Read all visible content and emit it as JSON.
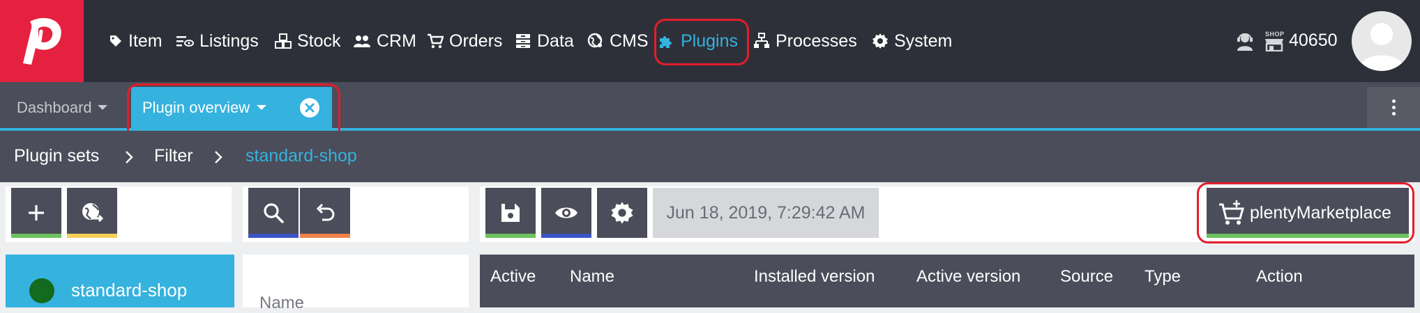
{
  "nav": {
    "items": [
      {
        "label": "Item",
        "icon": "tag-icon"
      },
      {
        "label": "Listings",
        "icon": "listings-icon"
      },
      {
        "label": "Stock",
        "icon": "cubes-icon"
      },
      {
        "label": "CRM",
        "icon": "users-icon"
      },
      {
        "label": "Orders",
        "icon": "cart-icon"
      },
      {
        "label": "Data",
        "icon": "archive-icon"
      },
      {
        "label": "CMS",
        "icon": "globe-icon"
      },
      {
        "label": "Plugins",
        "icon": "puzzle-icon",
        "active": true
      },
      {
        "label": "Processes",
        "icon": "sitemap-icon"
      },
      {
        "label": "System",
        "icon": "gear-icon"
      }
    ],
    "shop_badge": "SHOP",
    "shop_id": "40650"
  },
  "tabs": {
    "dashboard": "Dashboard",
    "plugin_overview": "Plugin overview"
  },
  "breadcrumb": {
    "items": [
      "Plugin sets",
      "Filter",
      "standard-shop"
    ]
  },
  "toolbar": {
    "timestamp": "Jun 18, 2019, 7:29:42 AM",
    "marketplace_label": "plentyMarketplace"
  },
  "sidebar": {
    "active_set": "standard-shop"
  },
  "filter": {
    "name_label": "Name"
  },
  "table": {
    "headers": [
      "Active",
      "Name",
      "Installed version",
      "Active version",
      "Source",
      "Type",
      "Action"
    ]
  },
  "colors": {
    "brand": "#e5213f",
    "accent": "#35b2de",
    "nav_bg": "#2e3039",
    "bar_green": "#6cc25f",
    "bar_yellow": "#f5cf57",
    "bar_blue": "#3d55c4",
    "bar_orange": "#f0834c",
    "status_green": "#136b1f",
    "highlight_red": "#e31d2c"
  }
}
